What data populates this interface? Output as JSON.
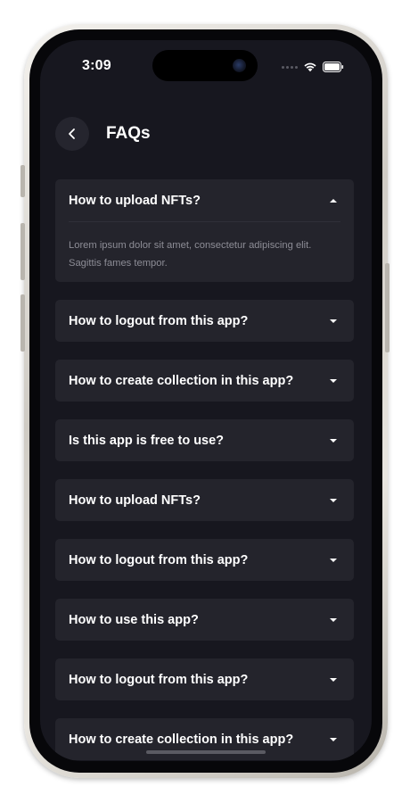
{
  "status_bar": {
    "time": "3:09"
  },
  "header": {
    "title": "FAQs"
  },
  "faqs": [
    {
      "question": "How to upload NFTs?",
      "answer": "Lorem ipsum dolor sit amet, consectetur adipiscing elit. Sagittis fames tempor.",
      "expanded": true
    },
    {
      "question": "How to logout from this app?",
      "expanded": false
    },
    {
      "question": "How to create collection in this app?",
      "expanded": false
    },
    {
      "question": "Is this app is free to use?",
      "expanded": false
    },
    {
      "question": "How to upload NFTs?",
      "expanded": false
    },
    {
      "question": "How to logout from this app?",
      "expanded": false
    },
    {
      "question": "How to use this app?",
      "expanded": false
    },
    {
      "question": "How to logout from this app?",
      "expanded": false
    },
    {
      "question": "How to create collection in this app?",
      "expanded": false
    }
  ],
  "colors": {
    "background": "#17171f",
    "card": "#24242c",
    "text_primary": "#ffffff",
    "text_secondary": "#8d8d96"
  }
}
